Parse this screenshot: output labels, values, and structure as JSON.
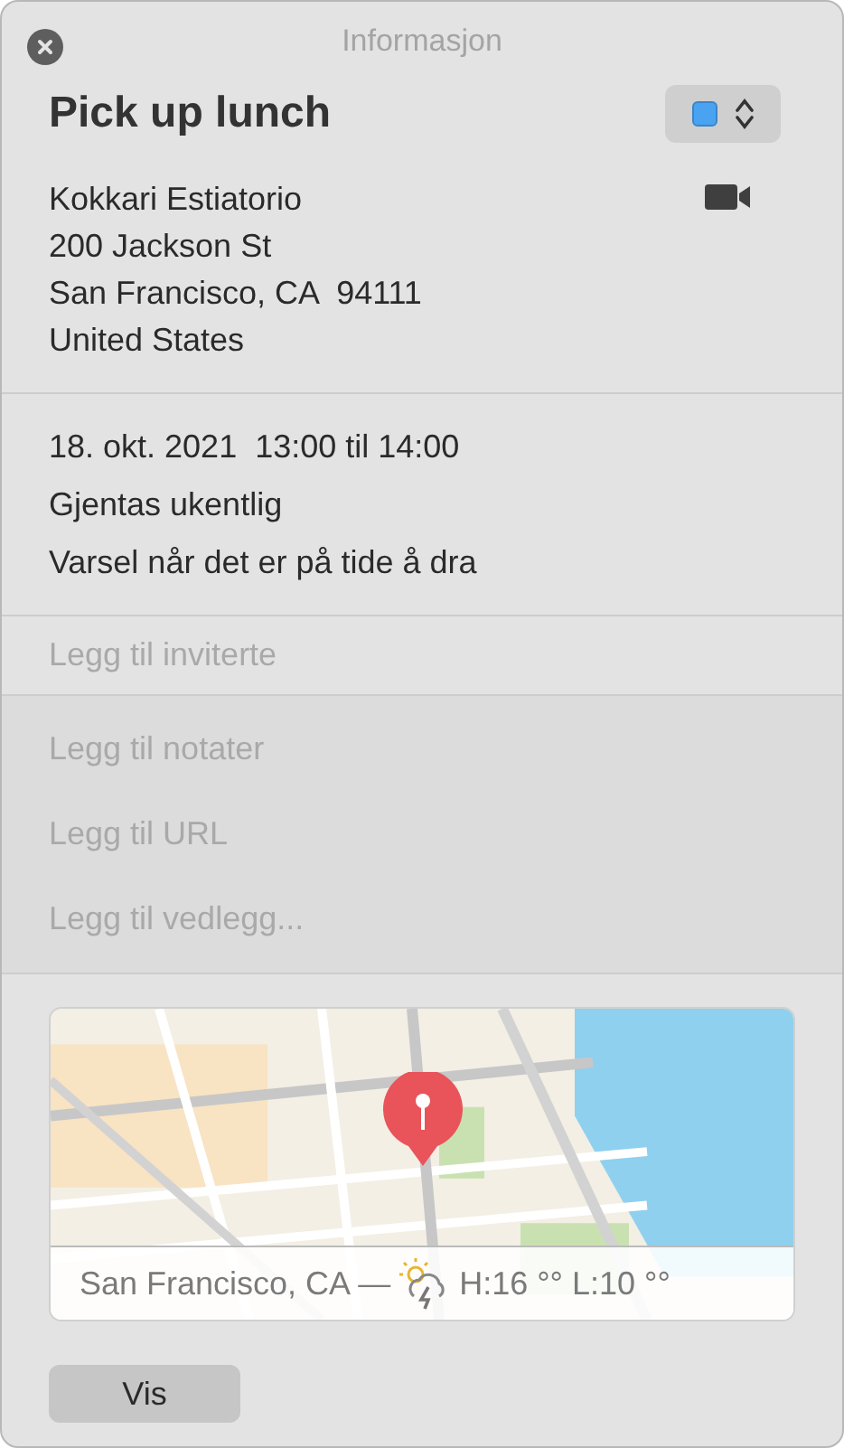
{
  "window": {
    "title": "Informasjon"
  },
  "event": {
    "title": "Pick up lunch",
    "color": "#4aa3f0",
    "video": true
  },
  "location_lines": [
    "Kokkari Estiatorio",
    "200 Jackson St",
    "San Francisco, CA  94111",
    "United States"
  ],
  "details": [
    "18. okt. 2021  13:00 til 14:00",
    "Gjentas ukentlig",
    "Varsel når det er på tide å dra"
  ],
  "invitees": {
    "placeholder": "Legg til inviterte"
  },
  "extras": [
    {
      "placeholder": "Legg til notater"
    },
    {
      "placeholder": "Legg til URL"
    },
    {
      "placeholder": "Legg til vedlegg..."
    }
  ],
  "map": {
    "kind": "picture",
    "weather": {
      "place": "San Francisco, CA —",
      "forecast": "H:16 °° L:10 °°"
    }
  },
  "buttons": [
    "Vis"
  ]
}
